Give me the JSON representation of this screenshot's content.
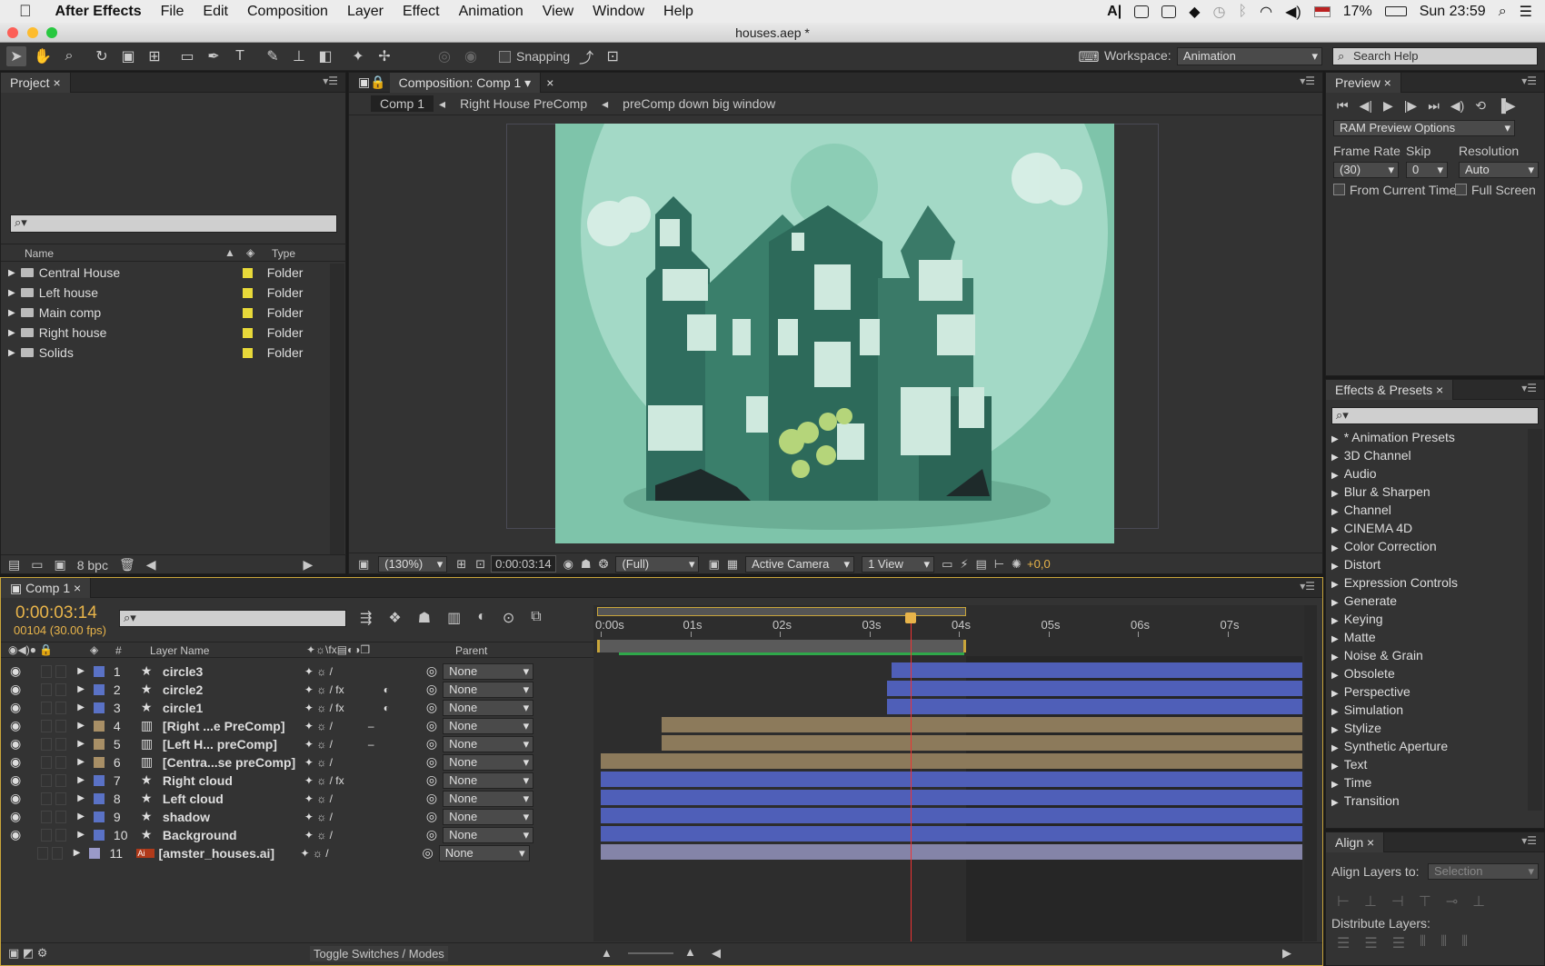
{
  "menubar": {
    "app": "After Effects",
    "items": [
      "File",
      "Edit",
      "Composition",
      "Layer",
      "Effect",
      "Animation",
      "View",
      "Window",
      "Help"
    ],
    "battery": "17%",
    "clock": "Sun 23:59"
  },
  "window": {
    "title": "houses.aep *"
  },
  "toolbar": {
    "snapping": "Snapping",
    "workspace_label": "Workspace:",
    "workspace_value": "Animation",
    "search_placeholder": "Search Help"
  },
  "project": {
    "tab": "Project",
    "col_name": "Name",
    "col_type": "Type",
    "items": [
      {
        "name": "Central House",
        "type": "Folder"
      },
      {
        "name": "Left house",
        "type": "Folder"
      },
      {
        "name": "Main comp",
        "type": "Folder"
      },
      {
        "name": "Right house",
        "type": "Folder"
      },
      {
        "name": "Solids",
        "type": "Folder"
      }
    ],
    "bpc": "8 bpc"
  },
  "composition": {
    "tab": "Composition: Comp 1",
    "breadcrumbs": [
      "Comp 1",
      "Right House PreComp",
      "preComp down big window"
    ],
    "zoom": "(130%)",
    "timecode": "0:00:03:14",
    "resolution": "(Full)",
    "camera": "Active Camera",
    "views": "1 View",
    "exposure": "+0,0"
  },
  "preview": {
    "tab": "Preview",
    "ram": "RAM Preview Options",
    "frame_rate_label": "Frame Rate",
    "skip_label": "Skip",
    "resolution_label": "Resolution",
    "frame_rate": "(30)",
    "skip": "0",
    "resolution": "Auto",
    "from_current": "From Current Time",
    "full_screen": "Full Screen"
  },
  "effects": {
    "tab": "Effects & Presets",
    "items": [
      "* Animation Presets",
      "3D Channel",
      "Audio",
      "Blur & Sharpen",
      "Channel",
      "CINEMA 4D",
      "Color Correction",
      "Distort",
      "Expression Controls",
      "Generate",
      "Keying",
      "Matte",
      "Noise & Grain",
      "Obsolete",
      "Perspective",
      "Simulation",
      "Stylize",
      "Synthetic Aperture",
      "Text",
      "Time",
      "Transition"
    ]
  },
  "align": {
    "tab": "Align",
    "align_to_label": "Align Layers to:",
    "align_to_value": "Selection",
    "distribute": "Distribute Layers:"
  },
  "timeline": {
    "tab": "Comp 1",
    "timecode": "0:00:03:14",
    "frames": "00104 (30.00 fps)",
    "col_num": "#",
    "col_layer": "Layer Name",
    "col_parent": "Parent",
    "ruler": [
      "0:00s",
      "01s",
      "02s",
      "03s",
      "04s",
      "05s",
      "06s",
      "07s"
    ],
    "toggle": "Toggle Switches / Modes",
    "layers": [
      {
        "n": "1",
        "name": "circle3",
        "color": "#5a72c6",
        "type": "star",
        "fx": false,
        "parent": "None",
        "start": 3.25,
        "bar": "#4f5fb8"
      },
      {
        "n": "2",
        "name": "circle2",
        "color": "#5a72c6",
        "type": "star",
        "fx": true,
        "parent": "None",
        "start": 3.2,
        "bar": "#4f5fb8"
      },
      {
        "n": "3",
        "name": "circle1",
        "color": "#5a72c6",
        "type": "star",
        "fx": true,
        "parent": "None",
        "start": 3.2,
        "bar": "#4f5fb8"
      },
      {
        "n": "4",
        "name": "[Right ...e PreComp]",
        "color": "#a88f66",
        "type": "comp",
        "fx": false,
        "parent": "None",
        "start": 0.68,
        "bar": "#8c7a5b"
      },
      {
        "n": "5",
        "name": "[Left H... preComp]",
        "color": "#a88f66",
        "type": "comp",
        "fx": false,
        "parent": "None",
        "start": 0.68,
        "bar": "#8c7a5b"
      },
      {
        "n": "6",
        "name": "[Centra...se preComp]",
        "color": "#a88f66",
        "type": "comp",
        "fx": false,
        "parent": "None",
        "start": 0,
        "bar": "#8c7a5b"
      },
      {
        "n": "7",
        "name": "Right cloud",
        "color": "#5a72c6",
        "type": "star",
        "fx": true,
        "parent": "None",
        "start": 0,
        "bar": "#4f5fb8"
      },
      {
        "n": "8",
        "name": "Left cloud",
        "color": "#5a72c6",
        "type": "star",
        "fx": false,
        "parent": "None",
        "start": 0,
        "bar": "#4f5fb8"
      },
      {
        "n": "9",
        "name": "shadow",
        "color": "#5a72c6",
        "type": "star",
        "fx": false,
        "parent": "None",
        "start": 0,
        "bar": "#4f5fb8"
      },
      {
        "n": "10",
        "name": "Background",
        "color": "#5a72c6",
        "type": "star",
        "fx": false,
        "parent": "None",
        "start": 0,
        "bar": "#4f5fb8"
      },
      {
        "n": "11",
        "name": "[amster_houses.ai]",
        "color": "#9a9ac8",
        "type": "ai",
        "fx": false,
        "parent": "None",
        "start": 0,
        "bar": "#8484a8"
      }
    ]
  }
}
